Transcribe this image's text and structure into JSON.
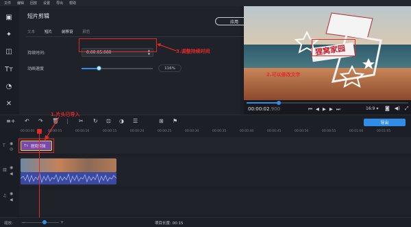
{
  "menu": [
    "文件",
    "编辑",
    "回放",
    "设置",
    "导出",
    "帮助"
  ],
  "panel": {
    "title": "短片剪辑",
    "apply_label": "应用",
    "tabs": [
      "文本",
      "短片",
      "前移设",
      "颜色"
    ],
    "active_tab": 1,
    "duration_label": "持续时间:",
    "duration_value": "0:00:05:000",
    "speed_label": "动画速度",
    "speed_value": "116%",
    "speed_fraction": 0.24
  },
  "annotations": {
    "a1": "1.片头已导入",
    "a2": "2.可以修改文字",
    "a3": "3.调整持续时间"
  },
  "preview": {
    "overlay_text": "狸窝家园",
    "timecode": "00:00:02",
    "timecode_ms": ".900",
    "ratio": "16:9 ▾",
    "progress_fraction": 0.2
  },
  "timeline": {
    "export_label": "导出",
    "ruler_ticks": [
      "00:00:00",
      "00:00:05",
      "00:00:10",
      "00:00:15",
      "00:00:20",
      "00:00:25",
      "00:00:30",
      "00:00:35",
      "00:00:40",
      "00:00:45",
      "00:00:50",
      "00:00:55",
      "00:01:00",
      "00:01:05"
    ],
    "title_clip_label": "狸窝剪辑"
  },
  "status": {
    "scale_label": "缩放:",
    "length_label": "项目长度: 00:15"
  },
  "colors": {
    "accent": "#2f8fe8",
    "annotation": "#e22a2a",
    "title_clip": "#7b4aa8"
  }
}
